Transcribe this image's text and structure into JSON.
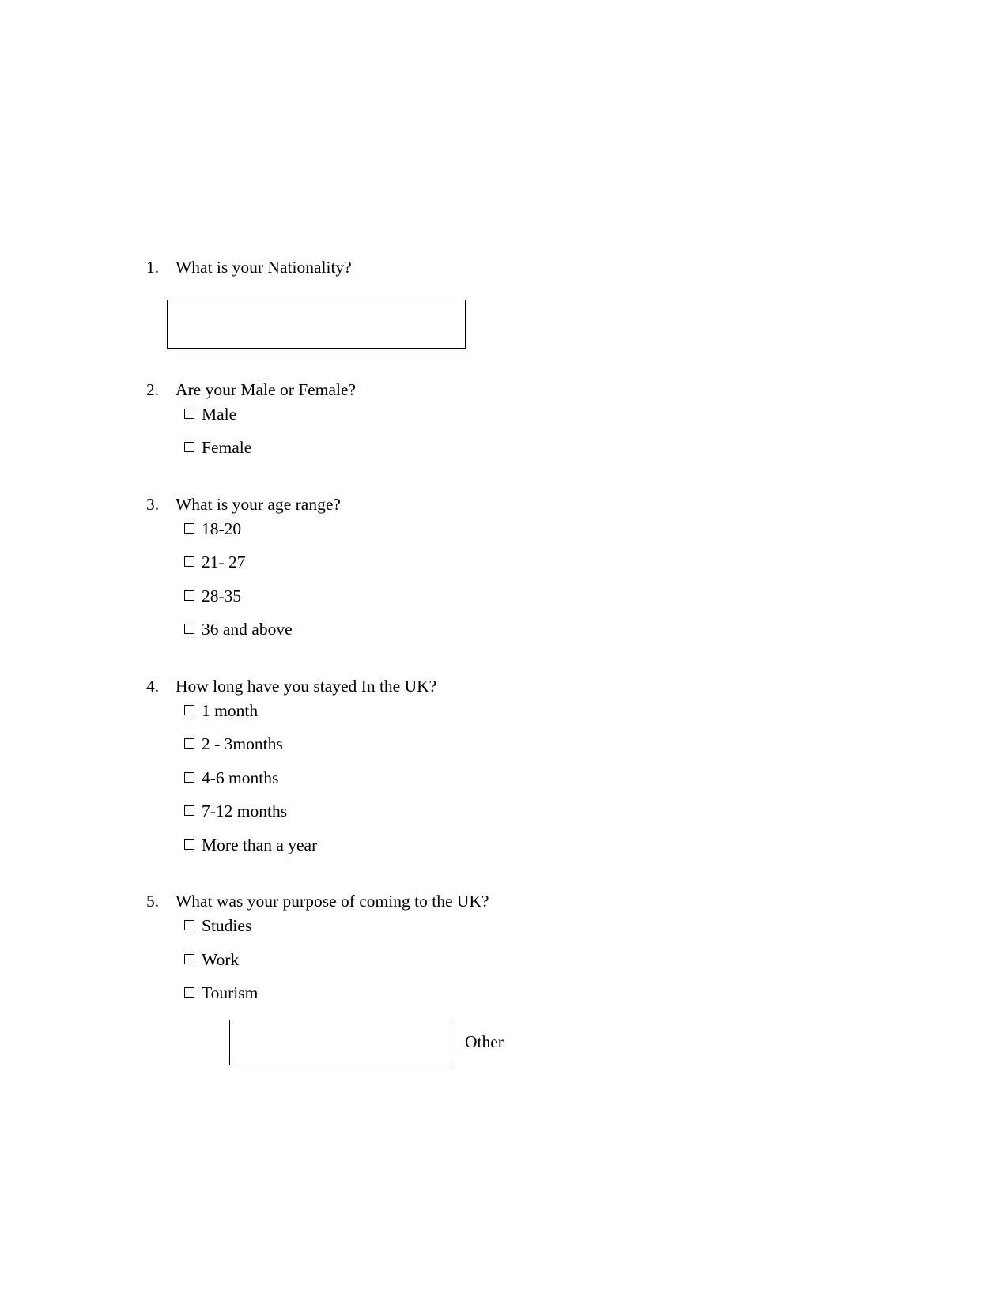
{
  "document": {
    "type": "questionnaire",
    "page_background": "#ffffff",
    "text_color": "#000000",
    "questions": [
      {
        "number": "1.",
        "text": "What is your Nationality?",
        "answer_type": "text-box",
        "input": {
          "value": "",
          "placeholder": ""
        },
        "options": []
      },
      {
        "number": "2.",
        "text": "Are your Male or Female?",
        "answer_type": "checkbox-list",
        "options": [
          {
            "label": "Male",
            "checked": false
          },
          {
            "label": "Female",
            "checked": false
          }
        ]
      },
      {
        "number": "3.",
        "text": "What is your age range?",
        "answer_type": "checkbox-list",
        "options": [
          {
            "label": "18-20",
            "checked": false
          },
          {
            "label": "21- 27",
            "checked": false
          },
          {
            "label": "28-35",
            "checked": false
          },
          {
            "label": "36 and above",
            "checked": false
          }
        ]
      },
      {
        "number": "4.",
        "text": "How long have you stayed In the UK?",
        "answer_type": "checkbox-list",
        "options": [
          {
            "label": "1 month",
            "checked": false
          },
          {
            "label": "2 - 3months",
            "checked": false
          },
          {
            "label": "4-6 months",
            "checked": false
          },
          {
            "label": "7-12 months",
            "checked": false
          },
          {
            "label": "More than a year",
            "checked": false
          }
        ]
      },
      {
        "number": "5.",
        "text": "What was your purpose of coming to the UK?",
        "answer_type": "checkbox-list-with-other",
        "options": [
          {
            "label": "Studies",
            "checked": false
          },
          {
            "label": "Work",
            "checked": false
          },
          {
            "label": "Tourism",
            "checked": false
          }
        ],
        "other": {
          "label": "Other",
          "input": {
            "value": "",
            "placeholder": ""
          }
        }
      }
    ]
  }
}
